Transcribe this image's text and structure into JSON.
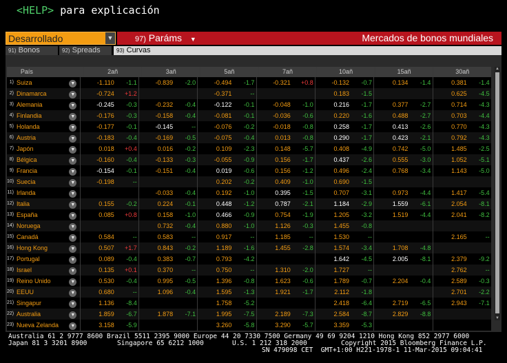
{
  "help": {
    "key": "<HELP>",
    "text": "para explicación"
  },
  "selector": {
    "value": "Desarrollado"
  },
  "toolbar": {
    "params_num": "97)",
    "params_label": "Paráms",
    "title": "Mercados de bonos mundiales"
  },
  "tabs": [
    {
      "num": "91)",
      "label": "Bonos",
      "active": false
    },
    {
      "num": "92)",
      "label": "Spreads",
      "active": false
    },
    {
      "num": "93)",
      "label": "Curvas",
      "active": true
    }
  ],
  "table": {
    "country_header": "País",
    "columns": [
      "2añ",
      "3añ",
      "5añ",
      "7añ",
      "10añ",
      "15añ",
      "30añ"
    ],
    "rows": [
      {
        "idx": "1)",
        "name": "Suiza",
        "cells": [
          [
            "-1.110",
            "-1.1",
            "o"
          ],
          [
            "-0.839",
            "-2.0",
            "o"
          ],
          [
            "-0.494",
            "-1.7",
            "o"
          ],
          [
            "-0.321",
            "+0.8",
            "o"
          ],
          [
            "-0.132",
            "-0.7",
            "o"
          ],
          [
            "0.134",
            "-1.4",
            "o"
          ],
          [
            "0.381",
            "-1.4",
            "o"
          ]
        ]
      },
      {
        "idx": "2)",
        "name": "Dinamarca",
        "cells": [
          [
            "-0.724",
            "+1.2",
            "o"
          ],
          [
            "",
            "",
            ""
          ],
          [
            "-0.371",
            "--",
            "o"
          ],
          [
            "",
            "",
            ""
          ],
          [
            "0.183",
            "-1.5",
            "o"
          ],
          [
            "",
            "",
            ""
          ],
          [
            "0.625",
            "-4.5",
            "o"
          ]
        ]
      },
      {
        "idx": "3)",
        "name": "Alemania",
        "cells": [
          [
            "-0.245",
            "-0.3",
            "w"
          ],
          [
            "-0.232",
            "-0.4",
            "o"
          ],
          [
            "-0.122",
            "-0.1",
            "w"
          ],
          [
            "-0.048",
            "-1.0",
            "o"
          ],
          [
            "0.216",
            "-1.7",
            "w"
          ],
          [
            "0.377",
            "-2.7",
            "o"
          ],
          [
            "0.714",
            "-4.3",
            "o"
          ]
        ]
      },
      {
        "idx": "4)",
        "name": "Finlandia",
        "cells": [
          [
            "-0.176",
            "-0.3",
            "o"
          ],
          [
            "-0.158",
            "-0.4",
            "o"
          ],
          [
            "-0.081",
            "-0.1",
            "o"
          ],
          [
            "-0.036",
            "-0.6",
            "o"
          ],
          [
            "0.220",
            "-1.6",
            "o"
          ],
          [
            "0.488",
            "-2.7",
            "o"
          ],
          [
            "0.703",
            "-4.4",
            "o"
          ]
        ]
      },
      {
        "idx": "5)",
        "name": "Holanda",
        "cells": [
          [
            "-0.177",
            "-0.1",
            "o"
          ],
          [
            "-0.145",
            "--",
            "w"
          ],
          [
            "-0.076",
            "-0.2",
            "o"
          ],
          [
            "-0.018",
            "-0.8",
            "o"
          ],
          [
            "0.258",
            "-1.7",
            "w"
          ],
          [
            "0.413",
            "-2.6",
            "w"
          ],
          [
            "0.770",
            "-4.3",
            "o"
          ]
        ]
      },
      {
        "idx": "6)",
        "name": "Austria",
        "cells": [
          [
            "-0.183",
            "-0.4",
            "o"
          ],
          [
            "-0.169",
            "-0.5",
            "o"
          ],
          [
            "-0.075",
            "-0.4",
            "o"
          ],
          [
            "0.013",
            "-0.8",
            "o"
          ],
          [
            "0.290",
            "-1.7",
            "w"
          ],
          [
            "0.423",
            "-2.1",
            "w"
          ],
          [
            "0.792",
            "-4.3",
            "o"
          ]
        ]
      },
      {
        "idx": "7)",
        "name": "Japón",
        "cells": [
          [
            "0.018",
            "+0.4",
            "o"
          ],
          [
            "0.016",
            "-0.2",
            "o"
          ],
          [
            "0.109",
            "-2.3",
            "o"
          ],
          [
            "0.148",
            "-5.7",
            "o"
          ],
          [
            "0.408",
            "-4.9",
            "o"
          ],
          [
            "0.742",
            "-5.0",
            "o"
          ],
          [
            "1.485",
            "-2.5",
            "o"
          ]
        ]
      },
      {
        "idx": "8)",
        "name": "Bélgica",
        "cells": [
          [
            "-0.160",
            "-0.4",
            "o"
          ],
          [
            "-0.133",
            "-0.3",
            "o"
          ],
          [
            "-0.055",
            "-0.9",
            "o"
          ],
          [
            "0.156",
            "-1.7",
            "o"
          ],
          [
            "0.437",
            "-2.6",
            "w"
          ],
          [
            "0.555",
            "-3.0",
            "o"
          ],
          [
            "1.052",
            "-5.1",
            "o"
          ]
        ]
      },
      {
        "idx": "9)",
        "name": "Francia",
        "cells": [
          [
            "-0.154",
            "-0.1",
            "w"
          ],
          [
            "-0.151",
            "-0.4",
            "o"
          ],
          [
            "0.019",
            "-0.6",
            "w"
          ],
          [
            "0.156",
            "-1.2",
            "o"
          ],
          [
            "0.496",
            "-2.4",
            "o"
          ],
          [
            "0.768",
            "-3.4",
            "o"
          ],
          [
            "1.143",
            "-5.0",
            "o"
          ]
        ]
      },
      {
        "idx": "10)",
        "name": "Suecia",
        "cells": [
          [
            "-0.198",
            "--",
            "o"
          ],
          [
            "",
            "",
            ""
          ],
          [
            "0.202",
            "-0.2",
            "o"
          ],
          [
            "0.409",
            "-1.0",
            "o"
          ],
          [
            "0.690",
            "-1.5",
            "o"
          ],
          [
            "",
            "",
            ""
          ],
          [
            "",
            "",
            ""
          ]
        ]
      },
      {
        "idx": "11)",
        "name": "Irlanda",
        "cells": [
          [
            "",
            "",
            ""
          ],
          [
            "-0.033",
            "-0.4",
            "o"
          ],
          [
            "0.192",
            "-1.0",
            "o"
          ],
          [
            "0.395",
            "-1.5",
            "w"
          ],
          [
            "0.707",
            "-3.1",
            "o"
          ],
          [
            "0.973",
            "-4.4",
            "o"
          ],
          [
            "1.417",
            "-5.4",
            "o"
          ]
        ]
      },
      {
        "idx": "12)",
        "name": "Italia",
        "cells": [
          [
            "0.155",
            "-0.2",
            "o"
          ],
          [
            "0.224",
            "-0.1",
            "o"
          ],
          [
            "0.448",
            "-1.2",
            "w"
          ],
          [
            "0.787",
            "-2.1",
            "w"
          ],
          [
            "1.184",
            "-2.9",
            "w"
          ],
          [
            "1.559",
            "-6.1",
            "w"
          ],
          [
            "2.054",
            "-8.1",
            "o"
          ]
        ]
      },
      {
        "idx": "13)",
        "name": "España",
        "cells": [
          [
            "0.085",
            "+0.8",
            "o"
          ],
          [
            "0.158",
            "-1.0",
            "o"
          ],
          [
            "0.466",
            "-0.9",
            "w"
          ],
          [
            "0.754",
            "-1.9",
            "o"
          ],
          [
            "1.205",
            "-3.2",
            "o"
          ],
          [
            "1.519",
            "-4.4",
            "o"
          ],
          [
            "2.041",
            "-8.2",
            "o"
          ]
        ]
      },
      {
        "idx": "14)",
        "name": "Noruega",
        "cells": [
          [
            "",
            "",
            ""
          ],
          [
            "0.732",
            "-0.4",
            "o"
          ],
          [
            "0.880",
            "-1.0",
            "o"
          ],
          [
            "1.126",
            "-0.3",
            "o"
          ],
          [
            "1.455",
            "-0.8",
            "o"
          ],
          [
            "",
            "",
            ""
          ],
          [
            "",
            "",
            ""
          ]
        ]
      },
      {
        "idx": "15)",
        "name": "Canadá",
        "cells": [
          [
            "0.584",
            "--",
            "o"
          ],
          [
            "0.583",
            "--",
            "o"
          ],
          [
            "0.917",
            "--",
            "o"
          ],
          [
            "1.185",
            "--",
            "o"
          ],
          [
            "1.530",
            "--",
            "o"
          ],
          [
            "",
            "",
            ""
          ],
          [
            "2.165",
            "--",
            "o"
          ]
        ]
      },
      {
        "idx": "16)",
        "name": "Hong Kong",
        "cells": [
          [
            "0.507",
            "+1.7",
            "o"
          ],
          [
            "0.843",
            "-0.2",
            "o"
          ],
          [
            "1.189",
            "-1.6",
            "o"
          ],
          [
            "1.455",
            "-2.8",
            "o"
          ],
          [
            "1.574",
            "-3.4",
            "o"
          ],
          [
            "1.708",
            "-4.8",
            "o"
          ],
          [
            "",
            "",
            ""
          ]
        ]
      },
      {
        "idx": "17)",
        "name": "Portugal",
        "cells": [
          [
            "0.089",
            "-0.4",
            "o"
          ],
          [
            "0.383",
            "-0.7",
            "o"
          ],
          [
            "0.793",
            "-4.2",
            "o"
          ],
          [
            "",
            "",
            ""
          ],
          [
            "1.642",
            "-4.5",
            "w"
          ],
          [
            "2.005",
            "-8.1",
            "w"
          ],
          [
            "2.379",
            "-9.2",
            "o"
          ]
        ]
      },
      {
        "idx": "18)",
        "name": "Israel",
        "cells": [
          [
            "0.135",
            "+0.1",
            "o"
          ],
          [
            "0.370",
            "--",
            "o"
          ],
          [
            "0.750",
            "--",
            "o"
          ],
          [
            "1.310",
            "-2.0",
            "o"
          ],
          [
            "1.727",
            "--",
            "o"
          ],
          [
            "",
            "",
            ""
          ],
          [
            "2.762",
            "--",
            "o"
          ]
        ]
      },
      {
        "idx": "19)",
        "name": "Reino Unido",
        "cells": [
          [
            "0.530",
            "-0.4",
            "o"
          ],
          [
            "0.995",
            "-0.5",
            "o"
          ],
          [
            "1.396",
            "-0.8",
            "o"
          ],
          [
            "1.623",
            "-0.6",
            "o"
          ],
          [
            "1.789",
            "-0.7",
            "o"
          ],
          [
            "2.204",
            "-0.4",
            "o"
          ],
          [
            "2.589",
            "-0.3",
            "o"
          ]
        ]
      },
      {
        "idx": "20)",
        "name": "EEUU",
        "cells": [
          [
            "0.680",
            "--",
            "o"
          ],
          [
            "1.096",
            "-0.4",
            "o"
          ],
          [
            "1.595",
            "-1.3",
            "o"
          ],
          [
            "1.921",
            "-1.7",
            "o"
          ],
          [
            "2.112",
            "-1.8",
            "o"
          ],
          [
            "",
            "",
            ""
          ],
          [
            "2.701",
            "-2.2",
            "o"
          ]
        ]
      },
      {
        "idx": "21)",
        "name": "Singapur",
        "cells": [
          [
            "1.136",
            "-8.4",
            "o"
          ],
          [
            "",
            "",
            ""
          ],
          [
            "1.758",
            "-5.2",
            "o"
          ],
          [
            "",
            "",
            ""
          ],
          [
            "2.418",
            "-6.4",
            "o"
          ],
          [
            "2.719",
            "-6.5",
            "o"
          ],
          [
            "2.943",
            "-7.1",
            "o"
          ]
        ]
      },
      {
        "idx": "22)",
        "name": "Australia",
        "cells": [
          [
            "1.859",
            "-6.7",
            "o"
          ],
          [
            "1.878",
            "-7.1",
            "o"
          ],
          [
            "1.995",
            "-7.5",
            "o"
          ],
          [
            "2.189",
            "-7.3",
            "o"
          ],
          [
            "2.584",
            "-8.7",
            "o"
          ],
          [
            "2.829",
            "-8.8",
            "o"
          ],
          [
            "",
            "",
            ""
          ]
        ]
      },
      {
        "idx": "23)",
        "name": "Nueva Zelanda",
        "cells": [
          [
            "3.158",
            "-5.9",
            "o"
          ],
          [
            "",
            "",
            ""
          ],
          [
            "3.260",
            "-5.8",
            "o"
          ],
          [
            "3.290",
            "-5.7",
            "o"
          ],
          [
            "3.359",
            "-5.3",
            "o"
          ],
          [
            "",
            "",
            ""
          ],
          [
            "",
            "",
            ""
          ]
        ]
      }
    ]
  },
  "colors": {
    "orange": "#f39c12",
    "red_bar": "#b8141e",
    "green": "#3fbf3f",
    "red": "#f03a3a"
  },
  "footer": {
    "line1": "Australia 61 2 9777 8600 Brazil 5511 2395 9000 Europe 44 20 7330 7500 Germany 49 69 9204 1210 Hong Kong 852 2977 6000",
    "line2a": "Japan 81 3 3201 8900",
    "line2b": "Singapore 65 6212 1000",
    "line2c": "U.S. 1 212 318 2000",
    "line2d": "Copyright 2015 Bloomberg Finance L.P.",
    "line3": "SN 479098 CET  GMT+1:00 H221-1978-1 11-Mar-2015 09:04:41"
  }
}
